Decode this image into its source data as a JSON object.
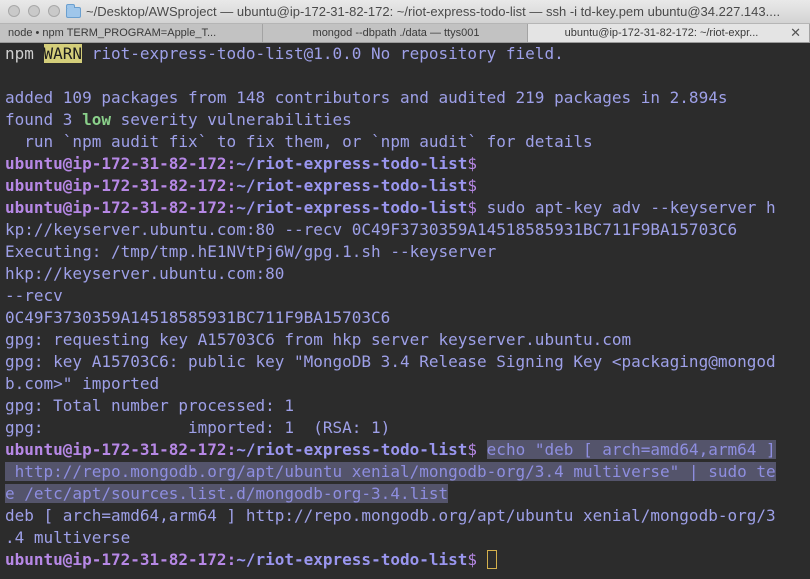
{
  "window": {
    "title": "~/Desktop/AWSproject — ubuntu@ip-172-31-82-172: ~/riot-express-todo-list — ssh -i td-key.pem ubuntu@34.227.143....",
    "folder_icon": "folder-icon"
  },
  "tabs": [
    {
      "label": "node • npm TERM_PROGRAM=Apple_T..."
    },
    {
      "label": "mongod --dbpath ./data — ttys001"
    },
    {
      "label": "ubuntu@ip-172-31-82-172: ~/riot-expr...",
      "close": "✕"
    }
  ],
  "prompt": {
    "user": "ubuntu@ip-172-31-82-172",
    "colon": ":",
    "path": "~/riot-express-todo-list",
    "dollar": "$"
  },
  "terminal": {
    "npm_warn_prefix": "npm ",
    "npm_warn_tag": "WARN",
    "npm_warn_msg": " riot-express-todo-list@1.0.0 No repository field.",
    "added": "added 109 packages from 148 contributors and audited 219 packages in 2.894s",
    "found_pre": "found 3 ",
    "found_low": "low",
    "found_post": " severity vulnerabilities",
    "run_fix": "  run `npm audit fix` to fix them, or `npm audit` for details",
    "cmd_apt_key": " sudo apt-key adv --keyserver h",
    "cmd_apt_key_cont": "kp://keyserver.ubuntu.com:80 --recv 0C49F3730359A14518585931BC711F9BA15703C6",
    "executing": "Executing: /tmp/tmp.hE1NVtPj6W/gpg.1.sh --keyserver",
    "hkp": "hkp://keyserver.ubuntu.com:80",
    "recv": "--recv",
    "key": "0C49F3730359A14518585931BC711F9BA15703C6",
    "gpg1": "gpg: requesting key A15703C6 from hkp server keyserver.ubuntu.com",
    "gpg2": "gpg: key A15703C6: public key \"MongoDB 3.4 Release Signing Key <packaging@mongod",
    "gpg2b": "b.com>\" imported",
    "gpg3": "gpg: Total number processed: 1",
    "gpg4": "gpg:               imported: 1  (RSA: 1)",
    "echo1": "echo \"deb [ arch=amd64,arm64 ]",
    "echo2": " http://repo.mongodb.org/apt/ubuntu xenial/mongodb-org/3.4 multiverse\" | sudo te",
    "echo3": "e /etc/apt/sources.list.d/mongodb-org-3.4.list",
    "deb1": "deb [ arch=amd64,arm64 ] http://repo.mongodb.org/apt/ubuntu xenial/mongodb-org/3",
    "deb2": ".4 multiverse"
  }
}
